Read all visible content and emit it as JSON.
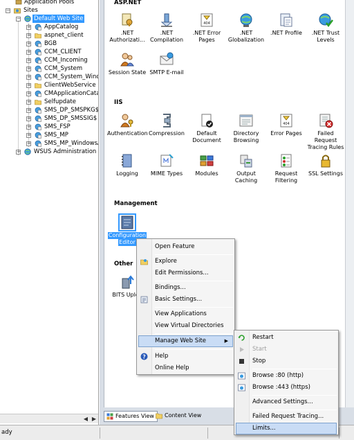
{
  "tree": {
    "items": [
      {
        "label": "Application Pools"
      },
      {
        "label": "Sites"
      },
      {
        "label": "Default Web Site"
      },
      {
        "label": "AppCatalog"
      },
      {
        "label": "aspnet_client"
      },
      {
        "label": "BGB"
      },
      {
        "label": "CCM_CLIENT"
      },
      {
        "label": "CCM_Incoming"
      },
      {
        "label": "CCM_System"
      },
      {
        "label": "CCM_System_Windo"
      },
      {
        "label": "ClientWebService"
      },
      {
        "label": "CMApplicationCatalo"
      },
      {
        "label": "Selfupdate"
      },
      {
        "label": "SMS_DP_SMSPKG$"
      },
      {
        "label": "SMS_DP_SMSSIG$"
      },
      {
        "label": "SMS_FSP"
      },
      {
        "label": "SMS_MP"
      },
      {
        "label": "SMS_MP_WindowsAu"
      },
      {
        "label": "WSUS Administration"
      }
    ]
  },
  "sections": {
    "aspnet": "ASP.NET",
    "iis": "IIS",
    "management": "Management",
    "other": "Other"
  },
  "features": {
    "aspnet": [
      {
        "line1": ".NET",
        "line2": "Authorizati...",
        "icon": "lock-key-icon"
      },
      {
        "line1": ".NET",
        "line2": "Compilation",
        "icon": "download-arrow-icon"
      },
      {
        "line1": ".NET Error",
        "line2": "Pages",
        "icon": "error-404-icon"
      },
      {
        "line1": ".NET",
        "line2": "Globalization",
        "icon": "globe-icon"
      },
      {
        "line1": ".NET Profile",
        "line2": "",
        "icon": "profile-doc-icon"
      },
      {
        "line1": ".NET Trust",
        "line2": "Levels",
        "icon": "globe-check-icon"
      },
      {
        "line1": "Session State",
        "line2": "",
        "icon": "users-icon"
      },
      {
        "line1": "SMTP E-mail",
        "line2": "",
        "icon": "email-icon"
      }
    ],
    "iis": [
      {
        "line1": "Authentication",
        "line2": "",
        "icon": "users-key-icon"
      },
      {
        "line1": "Compression",
        "line2": "",
        "icon": "clamp-icon"
      },
      {
        "line1": "Default",
        "line2": "Document",
        "icon": "document-check-icon"
      },
      {
        "line1": "Directory",
        "line2": "Browsing",
        "icon": "directory-icon"
      },
      {
        "line1": "Error Pages",
        "line2": "",
        "icon": "error-404-icon"
      },
      {
        "line1": "Failed Request",
        "line2": "Tracing Rules",
        "icon": "tracing-error-icon"
      },
      {
        "line1": "Logging",
        "line2": "",
        "icon": "log-book-icon"
      },
      {
        "line1": "MIME Types",
        "line2": "",
        "icon": "mime-icon"
      },
      {
        "line1": "Modules",
        "line2": "",
        "icon": "modules-icon"
      },
      {
        "line1": "Output",
        "line2": "Caching",
        "icon": "cache-icon"
      },
      {
        "line1": "Request",
        "line2": "Filtering",
        "icon": "filter-list-icon"
      },
      {
        "line1": "SSL Settings",
        "line2": "",
        "icon": "padlock-icon"
      }
    ],
    "management": [
      {
        "line1": "Configuration",
        "line2": "Editor",
        "icon": "config-editor-icon"
      }
    ],
    "other": [
      {
        "line1": "BITS Uploa",
        "line2": "",
        "icon": "bits-upload-icon"
      }
    ]
  },
  "context_menu": {
    "items": [
      {
        "label": "Open Feature"
      },
      {
        "label": "Explore"
      },
      {
        "label": "Edit Permissions..."
      },
      {
        "label": "Bindings..."
      },
      {
        "label": "Basic Settings..."
      },
      {
        "label": "View Applications"
      },
      {
        "label": "View Virtual Directories"
      },
      {
        "label": "Manage Web Site",
        "submenu_arrow": "▶"
      },
      {
        "label": "Help"
      },
      {
        "label": "Online Help"
      }
    ]
  },
  "submenu": {
    "items": [
      {
        "label": "Restart"
      },
      {
        "label": "Start"
      },
      {
        "label": "Stop"
      },
      {
        "label": "Browse :80 (http)"
      },
      {
        "label": "Browse :443 (https)"
      },
      {
        "label": "Advanced Settings..."
      },
      {
        "label": "Failed Request Tracing..."
      },
      {
        "label": "Limits..."
      }
    ]
  },
  "view_tabs": {
    "features_view": "Features View",
    "content_view": "Content View"
  },
  "status": {
    "text": "ady"
  },
  "scroll": {
    "left_arrow": "◀",
    "right_arrow": "▶"
  },
  "colors": {
    "selection": "#3399ff",
    "menu_highlight": "#c9dcf5",
    "pane_background": "#d8dee6"
  }
}
